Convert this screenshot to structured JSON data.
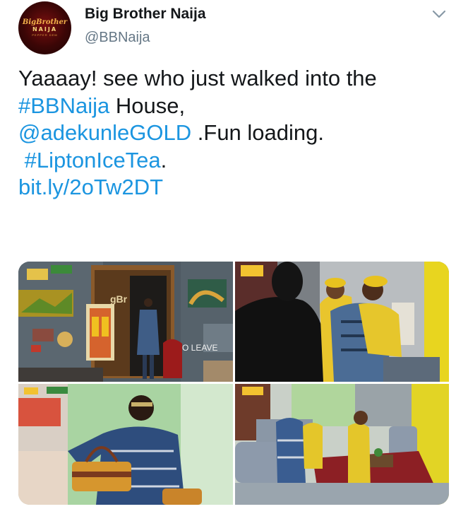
{
  "author": {
    "name": "Big Brother Naija",
    "handle": "@BBNaija",
    "avatar_text": [
      "BigBrother",
      "NAIJA",
      "PEPPER DEM"
    ]
  },
  "tweet": {
    "line1": "Yaaaay! see who just walked into the",
    "hashtag1": "#BBNaija",
    "line2_rest": " House,",
    "mention": "@adekunleGOLD",
    "line3_rest": " .Fun loading.",
    "hashtag2": "#LiptonIceTea",
    "line4_rest": ".",
    "short_link": "bit.ly/2oTw2DT"
  },
  "media": {
    "photo1_wall_text": "O LEAVE",
    "photo1_sign_text": "gBr"
  },
  "icons": {
    "more": "chevron-down-icon"
  },
  "colors": {
    "link": "#1b95e0",
    "secondary": "#657786",
    "text": "#14171a"
  }
}
